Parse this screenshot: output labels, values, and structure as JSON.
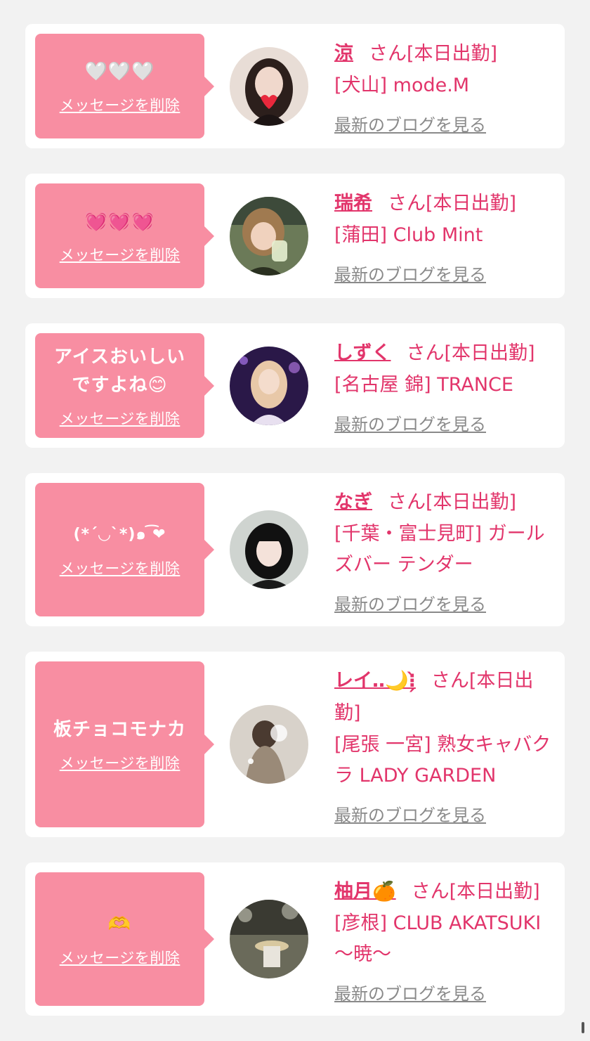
{
  "messages": [
    {
      "bubble_text": "🤍🤍🤍",
      "delete_label": "メッセージを削除",
      "name": "涼",
      "suffix": "さん[本日出勤]",
      "shop": "[犬山] mode.M",
      "blog_label": "最新のブログを見る",
      "avatar_color": "#3a2a28"
    },
    {
      "bubble_text": "💓💓💓",
      "delete_label": "メッセージを削除",
      "name": "瑞希",
      "suffix": "さん[本日出勤]",
      "shop": "[蒲田] Club Mint",
      "blog_label": "最新のブログを見る",
      "avatar_color": "#5a6a4a"
    },
    {
      "bubble_text": "アイスおいしいですよね😊",
      "delete_label": "メッセージを削除",
      "name": "しずく",
      "suffix": "さん[本日出勤]",
      "shop": "[名古屋 錦] TRANCE",
      "blog_label": "最新のブログを見る",
      "avatar_color": "#4a2a6a"
    },
    {
      "bubble_text": "(*´◡`*)๑ ͡❤",
      "delete_label": "メッセージを削除",
      "name": "なぎ",
      "suffix": "さん[本日出勤]",
      "shop": "[千葉・富士見町] ガールズバー テンダー",
      "blog_label": "最新のブログを見る",
      "avatar_color": "#2a2a2a"
    },
    {
      "bubble_text": "板チョコモナカ",
      "delete_label": "メッセージを削除",
      "name": "レイ‥🌙⁝̗̀",
      "suffix": "さん[本日出勤]",
      "shop": "[尾張 一宮] 熟女キャバクラ LADY GARDEN",
      "blog_label": "最新のブログを見る",
      "avatar_color": "#8a8070"
    },
    {
      "bubble_text": "🫶",
      "delete_label": "メッセージを削除",
      "name": "柚月🍊",
      "suffix": "さん[本日出勤]",
      "shop": "[彦根] CLUB AKATSUKI 〜暁〜",
      "blog_label": "最新のブログを見る",
      "avatar_color": "#4a4a3a"
    }
  ]
}
